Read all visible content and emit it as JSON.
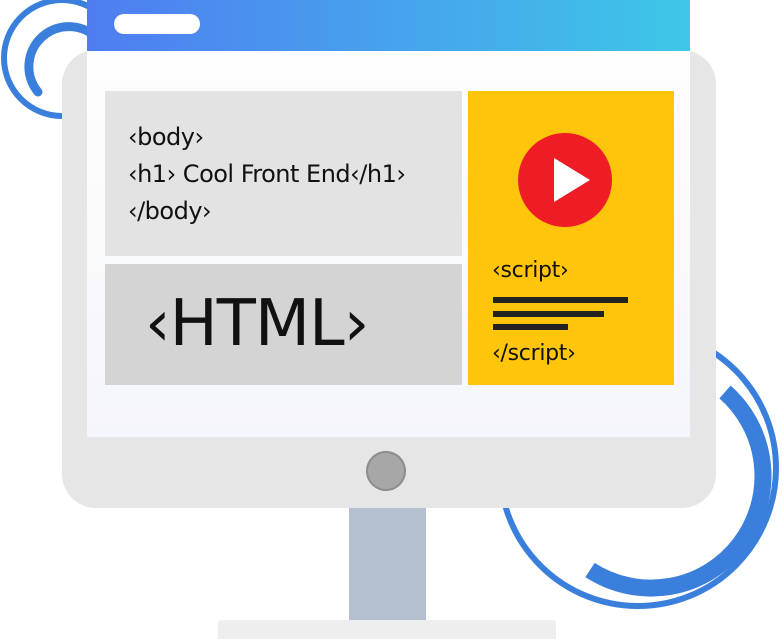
{
  "code_panel": {
    "lines": [
      "‹body›",
      "‹h1› Cool Front End‹/h1›",
      "‹/body›"
    ]
  },
  "html_panel": {
    "label": "‹HTML›"
  },
  "script_panel": {
    "open_tag": "‹script›",
    "close_tag": "‹/script›"
  },
  "icons": {
    "play": "play-icon"
  },
  "colors": {
    "topbar_start": "#4f7df1",
    "topbar_end": "#3ec7e8",
    "script_panel_bg": "#fec50b",
    "play_button": "#ee1c25",
    "deco_rings": "#3a7fdc",
    "monitor_frame": "#e6e6e6",
    "stand": "#b4c0cf"
  }
}
